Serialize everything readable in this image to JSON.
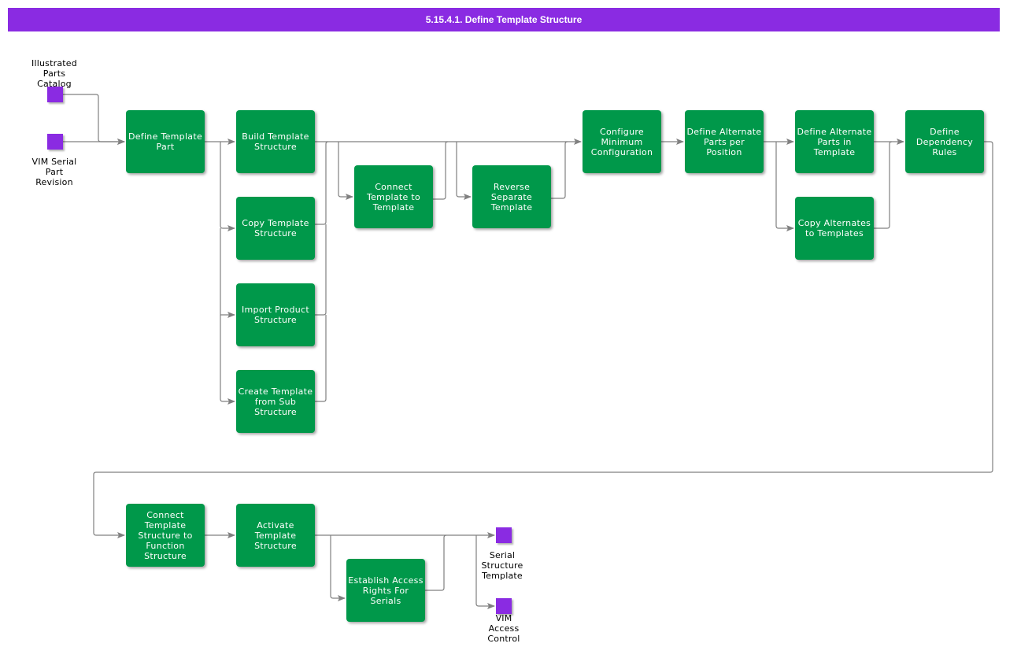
{
  "title": "5.15.4.1. Define Template Structure",
  "colors": {
    "title_bar": "#8a2be2",
    "process_node": "#00984a",
    "terminal_node": "#8a2be2",
    "connector": "#808080"
  },
  "inputs": [
    {
      "id": "illustrated-parts-catalog",
      "label": "Illustrated\nParts\nCatalog"
    },
    {
      "id": "vim-serial-part-revision",
      "label": "VIM Serial\nPart\nRevision"
    }
  ],
  "outputs": [
    {
      "id": "serial-structure-template",
      "label": "Serial\nStructure\nTemplate"
    },
    {
      "id": "vim-access-control",
      "label": "VIM\nAccess\nControl"
    }
  ],
  "processes": [
    {
      "id": "define-template-part",
      "label": "Define Template\nPart"
    },
    {
      "id": "build-template-structure",
      "label": "Build Template\nStructure"
    },
    {
      "id": "copy-template-structure",
      "label": "Copy Template\nStructure"
    },
    {
      "id": "import-product-structure",
      "label": "Import Product\nStructure"
    },
    {
      "id": "create-template-from-sub-structure",
      "label": "Create Template\nfrom Sub\nStructure"
    },
    {
      "id": "connect-template-to-template",
      "label": "Connect\nTemplate to\nTemplate"
    },
    {
      "id": "reverse-separate-template",
      "label": "Reverse\nSeparate\nTemplate"
    },
    {
      "id": "configure-minimum-configuration",
      "label": "Configure\nMinimum\nConfiguration"
    },
    {
      "id": "define-alternate-parts-per-position",
      "label": "Define Alternate\nParts per Position"
    },
    {
      "id": "define-alternate-parts-in-template",
      "label": "Define Alternate\nParts in Template"
    },
    {
      "id": "copy-alternates-to-templates",
      "label": "Copy Alternates\nto Templates"
    },
    {
      "id": "define-dependency-rules",
      "label": "Define\nDependency\nRules"
    },
    {
      "id": "connect-template-structure-to-function-structure",
      "label": "Connect\nTemplate\nStructure to\nFunction\nStructure"
    },
    {
      "id": "activate-template-structure",
      "label": "Activate\nTemplate\nStructure"
    },
    {
      "id": "establish-access-rights-for-serials",
      "label": "Establish Access\nRights For Serials"
    }
  ],
  "edges": [
    {
      "from": "illustrated-parts-catalog",
      "to": "define-template-part"
    },
    {
      "from": "vim-serial-part-revision",
      "to": "define-template-part"
    },
    {
      "from": "define-template-part",
      "to": "build-template-structure"
    },
    {
      "from": "define-template-part",
      "to": "copy-template-structure"
    },
    {
      "from": "define-template-part",
      "to": "import-product-structure"
    },
    {
      "from": "define-template-part",
      "to": "create-template-from-sub-structure"
    },
    {
      "from": "build-template-structure",
      "to": "connect-template-to-template"
    },
    {
      "from": "build-template-structure",
      "to": "reverse-separate-template"
    },
    {
      "from": "build-template-structure",
      "to": "configure-minimum-configuration"
    },
    {
      "from": "copy-template-structure",
      "to": "connect-template-to-template"
    },
    {
      "from": "import-product-structure",
      "to": "connect-template-to-template"
    },
    {
      "from": "create-template-from-sub-structure",
      "to": "connect-template-to-template"
    },
    {
      "from": "connect-template-to-template",
      "to": "reverse-separate-template"
    },
    {
      "from": "reverse-separate-template",
      "to": "configure-minimum-configuration"
    },
    {
      "from": "configure-minimum-configuration",
      "to": "define-alternate-parts-per-position"
    },
    {
      "from": "define-alternate-parts-per-position",
      "to": "define-alternate-parts-in-template"
    },
    {
      "from": "define-alternate-parts-per-position",
      "to": "copy-alternates-to-templates"
    },
    {
      "from": "define-alternate-parts-in-template",
      "to": "define-dependency-rules"
    },
    {
      "from": "copy-alternates-to-templates",
      "to": "define-dependency-rules"
    },
    {
      "from": "define-dependency-rules",
      "to": "connect-template-structure-to-function-structure"
    },
    {
      "from": "connect-template-structure-to-function-structure",
      "to": "activate-template-structure"
    },
    {
      "from": "activate-template-structure",
      "to": "establish-access-rights-for-serials"
    },
    {
      "from": "activate-template-structure",
      "to": "serial-structure-template"
    },
    {
      "from": "establish-access-rights-for-serials",
      "to": "serial-structure-template"
    },
    {
      "from": "activate-template-structure",
      "to": "vim-access-control"
    }
  ]
}
